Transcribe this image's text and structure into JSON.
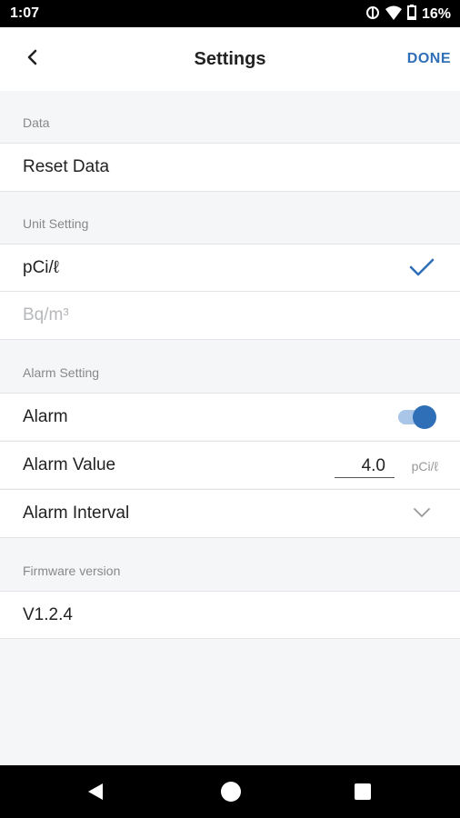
{
  "status_bar": {
    "time": "1:07",
    "battery": "16%"
  },
  "header": {
    "title": "Settings",
    "done_label": "DONE"
  },
  "sections": {
    "data": {
      "header": "Data",
      "reset_label": "Reset Data"
    },
    "unit": {
      "header": "Unit Setting",
      "option_selected": "pCi/ℓ",
      "option_other": "Bq/m³"
    },
    "alarm": {
      "header": "Alarm Setting",
      "alarm_label": "Alarm",
      "alarm_enabled": true,
      "alarm_value_label": "Alarm Value",
      "alarm_value": "4.0",
      "alarm_value_unit": "pCi/ℓ",
      "alarm_interval_label": "Alarm Interval"
    },
    "firmware": {
      "header": "Firmware version",
      "version": "V1.2.4"
    }
  },
  "colors": {
    "accent": "#2f6fb7",
    "toggle_track": "#a9c5e8",
    "background": "#f5f6f8"
  }
}
